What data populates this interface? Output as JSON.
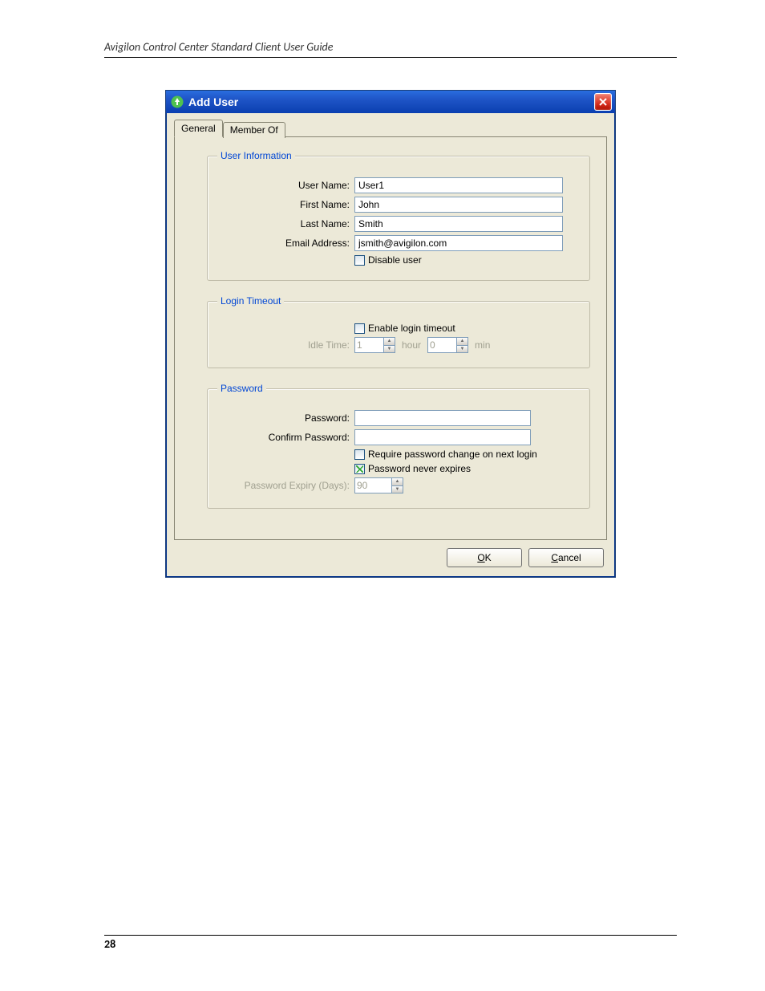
{
  "doc": {
    "header": "Avigilon Control Center Standard Client User Guide",
    "page_number": "28"
  },
  "dialog": {
    "title": "Add User",
    "tabs": {
      "general": "General",
      "member_of": "Member Of"
    },
    "groups": {
      "user_info": {
        "legend": "User Information",
        "labels": {
          "user_name": "User Name:",
          "first_name": "First Name:",
          "last_name": "Last Name:",
          "email": "Email Address:"
        },
        "values": {
          "user_name": "User1",
          "first_name": "John",
          "last_name": "Smith",
          "email": "jsmith@avigilon.com"
        },
        "disable_user": {
          "label": "Disable user",
          "checked": false
        }
      },
      "login_timeout": {
        "legend": "Login Timeout",
        "enable": {
          "label": "Enable login timeout",
          "checked": false
        },
        "idle_time_label": "Idle Time:",
        "hour_value": "1",
        "hour_unit": "hour",
        "min_value": "0",
        "min_unit": "min"
      },
      "password": {
        "legend": "Password",
        "labels": {
          "password": "Password:",
          "confirm": "Confirm Password:",
          "expiry": "Password Expiry (Days):"
        },
        "require_change": {
          "label": "Require password change on next login",
          "checked": false
        },
        "never_expires": {
          "label": "Password never expires",
          "checked": true
        },
        "expiry_value": "90"
      }
    },
    "buttons": {
      "ok_accel": "O",
      "ok_rest": "K",
      "cancel_accel": "C",
      "cancel_rest": "ancel"
    }
  }
}
